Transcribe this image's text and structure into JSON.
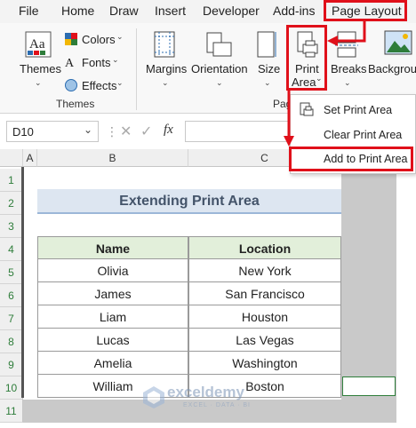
{
  "menu": {
    "items": [
      "File",
      "Home",
      "Draw",
      "Insert",
      "Developer",
      "Add-ins",
      "Page Layout"
    ]
  },
  "ribbon": {
    "themes": {
      "themes_label": "Themes",
      "colors_label": "Colors",
      "fonts_label": "Fonts",
      "effects_label": "Effects",
      "group_title": "Themes"
    },
    "page_setup": {
      "margins_label": "Margins",
      "orientation_label": "Orientation",
      "size_label": "Size",
      "print_area_label_1": "Print",
      "print_area_label_2": "Area",
      "breaks_label": "Breaks",
      "background_label": "Background",
      "group_title_partial": "Pag"
    }
  },
  "dropdown": {
    "items": [
      "Set Print Area",
      "Clear Print Area",
      "Add to Print Area"
    ]
  },
  "formula_bar": {
    "name_box": "D10",
    "fx": "fx"
  },
  "sheet": {
    "columns": [
      "A",
      "B",
      "C"
    ],
    "rows": [
      "1",
      "2",
      "3",
      "4",
      "5",
      "6",
      "7",
      "8",
      "9",
      "10",
      "11"
    ],
    "title": "Extending Print Area",
    "table": {
      "headers": [
        "Name",
        "Location"
      ],
      "rows": [
        [
          "Olivia",
          "New York"
        ],
        [
          "James",
          "San Francisco"
        ],
        [
          "Liam",
          "Houston"
        ],
        [
          "Lucas",
          "Las Vegas"
        ],
        [
          "Amelia",
          "Washington"
        ],
        [
          "William",
          "Boston"
        ]
      ]
    }
  },
  "watermark": {
    "name": "exceldemy",
    "tagline": "EXCEL · DATA · BI"
  },
  "colors": {
    "accent_red": "#e0101a",
    "title_fill": "#dde6f1",
    "header_fill": "#e2efda",
    "excel_green": "#217346"
  }
}
